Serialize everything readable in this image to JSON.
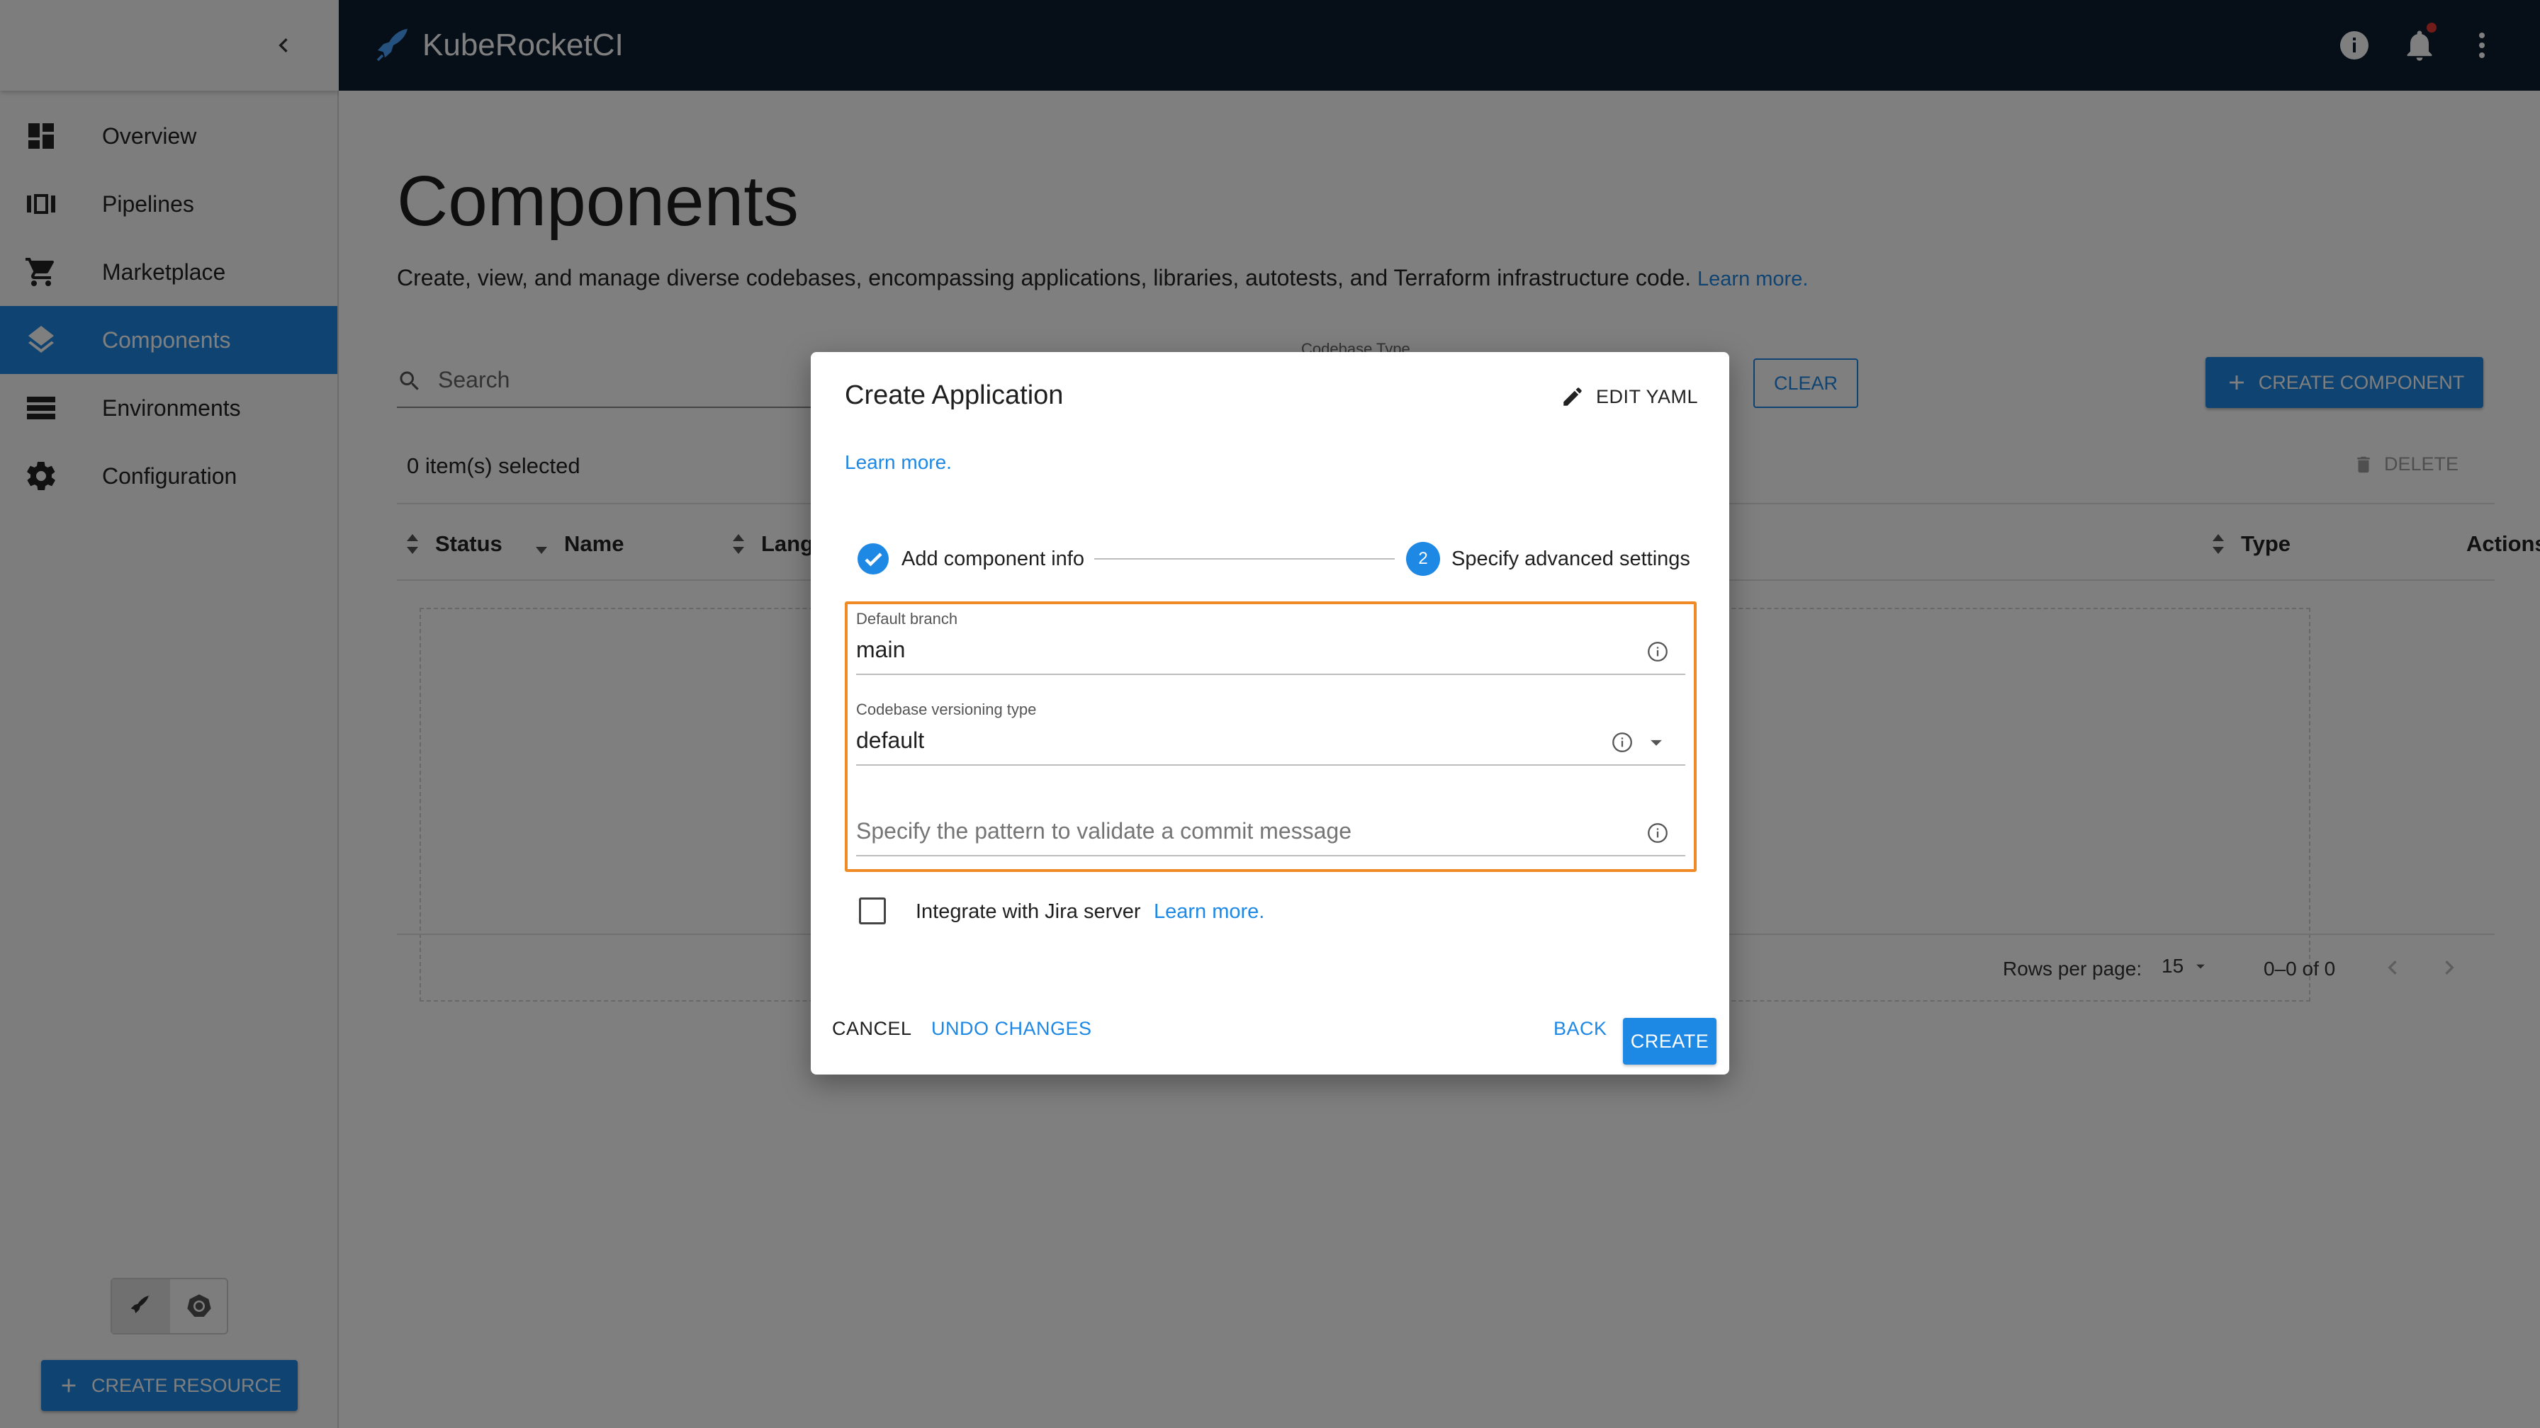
{
  "app": {
    "name": "KubeRocketCI"
  },
  "sidebar": {
    "items": [
      {
        "label": "Overview",
        "icon": "dashboard-icon",
        "active": false
      },
      {
        "label": "Pipelines",
        "icon": "pipelines-icon",
        "active": false
      },
      {
        "label": "Marketplace",
        "icon": "cart-icon",
        "active": false
      },
      {
        "label": "Components",
        "icon": "layers-icon",
        "active": true
      },
      {
        "label": "Environments",
        "icon": "storage-icon",
        "active": false
      },
      {
        "label": "Configuration",
        "icon": "gear-icon",
        "active": false
      }
    ],
    "create_resource_label": "CREATE RESOURCE"
  },
  "page": {
    "title": "Components",
    "description": "Create, view, and manage diverse codebases, encompassing applications, libraries, autotests, and Terraform infrastructure code.",
    "learn_more": "Learn more.",
    "search_placeholder": "Search",
    "codebase_type_label": "Codebase Type",
    "clear_label": "CLEAR",
    "create_component_label": "CREATE COMPONENT",
    "selected_text": "0 item(s) selected",
    "delete_label": "DELETE",
    "columns": [
      "Status",
      "Name",
      "Language",
      "Type",
      "Actions"
    ],
    "rows_per_page_label": "Rows per page:",
    "rows_per_page_value": "15",
    "pagination_range": "0–0 of 0"
  },
  "dialog": {
    "title": "Create Application",
    "edit_yaml_label": "EDIT YAML",
    "learn_more": "Learn more.",
    "steps": [
      {
        "label": "Add component info",
        "state": "done"
      },
      {
        "label": "Specify advanced settings",
        "number": "2",
        "state": "active"
      }
    ],
    "fields": {
      "default_branch_label": "Default branch",
      "default_branch_value": "main",
      "versioning_label": "Codebase versioning type",
      "versioning_value": "default",
      "commit_pattern_placeholder": "Specify the pattern to validate a commit message"
    },
    "jira_label": "Integrate with Jira server",
    "jira_learn_more": "Learn more.",
    "cancel_label": "CANCEL",
    "undo_label": "UNDO CHANGES",
    "back_label": "BACK",
    "create_label": "CREATE"
  },
  "colors": {
    "accent": "#1e88e5",
    "topbar": "#0c1c2e",
    "highlight": "#f08a24",
    "notification_dot": "#e53935"
  }
}
